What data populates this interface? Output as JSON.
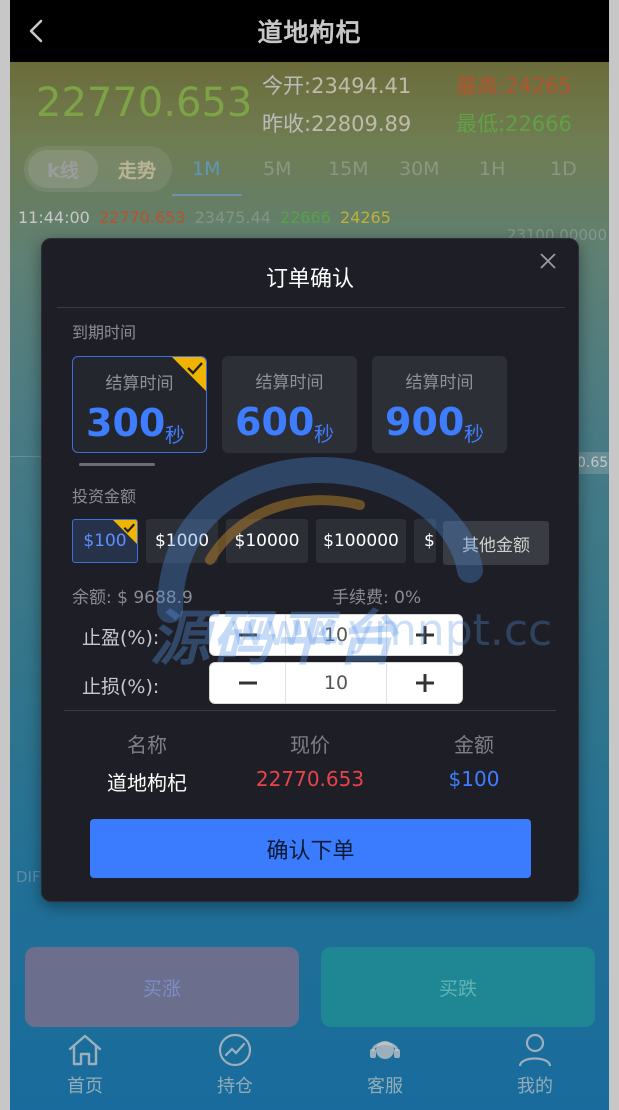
{
  "header": {
    "title": "道地枸杞"
  },
  "quote": {
    "price": "22770.653",
    "open_label": "今开:",
    "open": "23494.41",
    "prev_close_label": "昨收:",
    "prev_close": "22809.89",
    "high_label": "最高:",
    "high": "24265",
    "low_label": "最低:",
    "low": "22666"
  },
  "tabs": {
    "kline": "k线",
    "trend": "走势",
    "timeframes": [
      "1M",
      "5M",
      "15M",
      "30M",
      "1H",
      "1D"
    ]
  },
  "ticker": {
    "time": "11:44:00",
    "v1": "22770.653",
    "v2": "23475.44",
    "v3": "22666",
    "v4": "24265"
  },
  "axis": {
    "top": "23100.00000",
    "mid": "0.65",
    "side": "DIF"
  },
  "modal": {
    "title": "订单确认",
    "expiry_label": "到期时间",
    "expiry_options": [
      {
        "title": "结算时间",
        "value": "300",
        "unit": "秒"
      },
      {
        "title": "结算时间",
        "value": "600",
        "unit": "秒"
      },
      {
        "title": "结算时间",
        "value": "900",
        "unit": "秒"
      }
    ],
    "amount_label": "投资金额",
    "amounts": [
      "$100",
      "$1000",
      "$10000",
      "$100000",
      "$"
    ],
    "other_amount": "其他金额",
    "balance": "余额: $ 9688.9",
    "fee": "手续费: 0%",
    "take_profit_label": "止盈(%):",
    "take_profit": "10",
    "stop_loss_label": "止损(%):",
    "stop_loss": "10",
    "table": {
      "headers": [
        "名称",
        "现价",
        "金额"
      ],
      "row": {
        "name": "道地枸杞",
        "price": "22770.653",
        "amount": "$100"
      }
    },
    "confirm": "确认下单"
  },
  "actions": {
    "buy_up": "买涨",
    "buy_down": "买跌"
  },
  "nav": {
    "home": "首页",
    "positions": "持仓",
    "service": "客服",
    "mine": "我的"
  },
  "watermark": {
    "text": "源码平台",
    "url": "www.ymnpt.cc"
  },
  "colors": {
    "accent": "#3b7bfd",
    "up": "#e86b3a",
    "down": "#7ccf5a",
    "selected_badge": "#f0b400"
  }
}
